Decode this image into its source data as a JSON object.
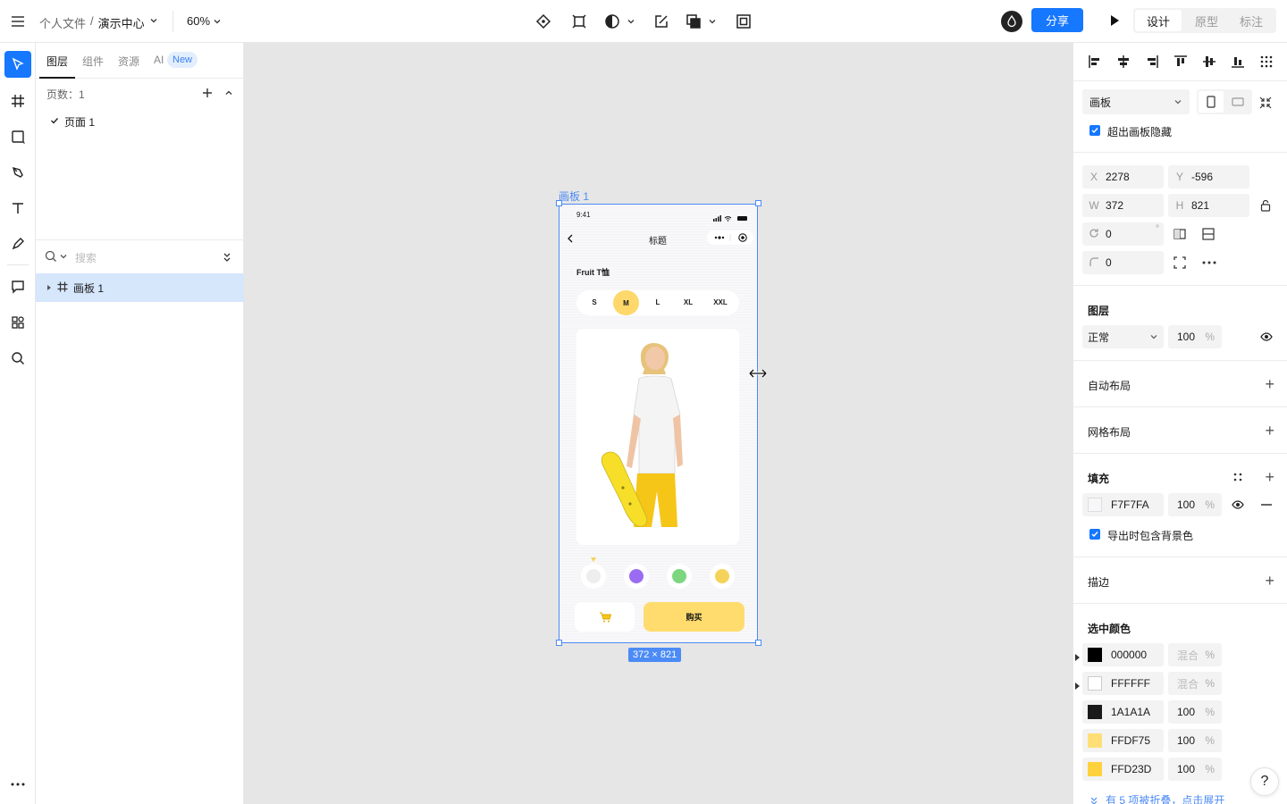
{
  "topbar": {
    "breadcrumb_folder": "个人文件",
    "breadcrumb_sep": "/",
    "file_name": "演示中心",
    "zoom": "60%",
    "share": "分享",
    "modes": [
      "设计",
      "原型",
      "标注"
    ]
  },
  "left_panel": {
    "tabs": [
      "图层",
      "组件",
      "资源",
      "AI"
    ],
    "ai_badge": "New",
    "page_count": "页数：1",
    "page_item": "页面 1",
    "search_placeholder": "搜索",
    "layer_item": "画板 1"
  },
  "canvas": {
    "frame_label": "画板 1",
    "size_badge": "372 × 821"
  },
  "phone": {
    "time": "9:41",
    "title": "标题",
    "product": "Fruit T恤",
    "sizes": [
      "S",
      "M",
      "L",
      "XL",
      "XXL"
    ],
    "selected_size": "M",
    "buy": "购买",
    "colors": [
      "#eeeeee",
      "#9b6cf2",
      "#7bd67f",
      "#f5d35a"
    ]
  },
  "right_panel": {
    "frame_type": "画板",
    "clip_content": "超出画板隐藏",
    "x_label": "X",
    "x": "2278",
    "y_label": "Y",
    "y": "-596",
    "w_label": "W",
    "w": "372",
    "h_label": "H",
    "h": "821",
    "rotation": "0",
    "degree": "°",
    "radius": "0",
    "layer_title": "图层",
    "blend_mode": "正常",
    "opacity": "100",
    "pct": "%",
    "auto_layout": "自动布局",
    "grid_layout": "网格布局",
    "fill_title": "填充",
    "fill_hex": "F7F7FA",
    "fill_opacity": "100",
    "export_bg": "导出时包含背景色",
    "stroke": "描边",
    "selected_colors_title": "选中颜色",
    "selected_colors": [
      {
        "hex": "000000",
        "opacity": "混合",
        "swatch": "#000000"
      },
      {
        "hex": "FFFFFF",
        "opacity": "混合",
        "swatch": "#ffffff"
      },
      {
        "hex": "1A1A1A",
        "opacity": "100",
        "swatch": "#1a1a1a"
      },
      {
        "hex": "FFDF75",
        "opacity": "100",
        "swatch": "#ffdf75"
      },
      {
        "hex": "FFD23D",
        "opacity": "100",
        "swatch": "#ffd23d"
      }
    ],
    "collapsed_note": "有 5 项被折叠，点击展开"
  },
  "help": "?"
}
